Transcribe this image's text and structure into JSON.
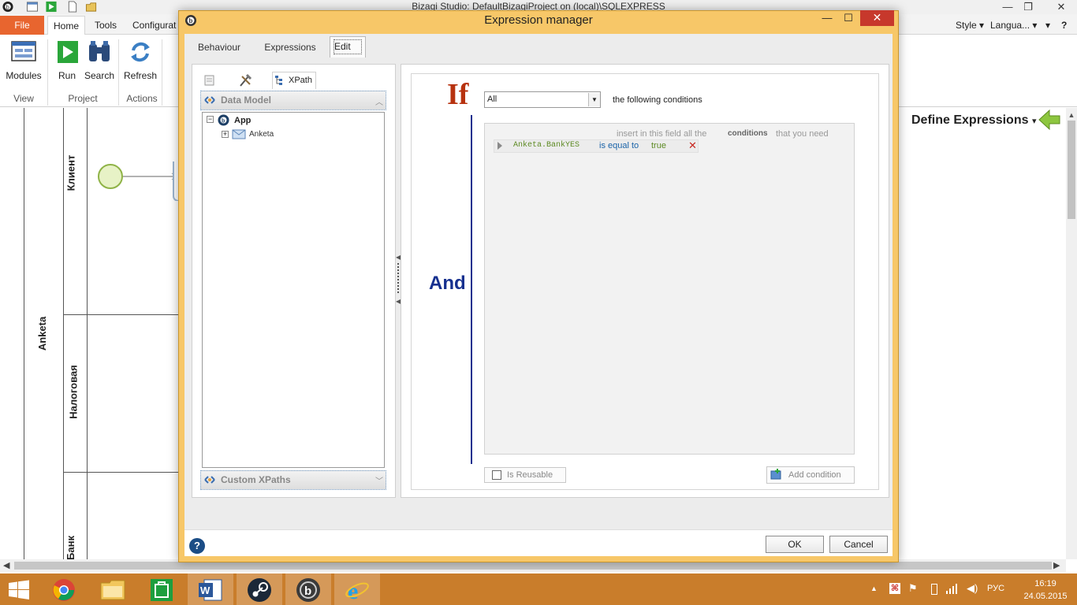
{
  "window": {
    "title": "Bizagi Studio: DefaultBizagiProject on (local)\\SQLEXPRESS",
    "minimize": "—",
    "restore": "❐",
    "close": "✕"
  },
  "ribbon": {
    "tabs": [
      "File",
      "Home",
      "Tools",
      "Configurat"
    ],
    "right": {
      "style": "Style",
      "language": "Langua..."
    },
    "buttons": {
      "modules": "Modules",
      "run": "Run",
      "search": "Search",
      "refresh": "Refresh"
    },
    "groups": {
      "view": "View",
      "project": "Project",
      "actions": "Actions"
    }
  },
  "diagram": {
    "pool": "Anketa",
    "lanes": [
      "Клиент",
      "Налоговая",
      "Банк"
    ]
  },
  "right_pane": {
    "title": "Define Expressions",
    "chevron": "▾"
  },
  "dialog": {
    "title": "Expression manager",
    "min": "—",
    "max": "☐",
    "close": "✕",
    "tabs": {
      "behaviour": "Behaviour",
      "expressions": "Expressions",
      "edit": "Edit"
    },
    "left": {
      "xpath_tab": "XPath",
      "data_model": "Data Model",
      "tree_root": "App",
      "tree_child": "Anketa",
      "custom_xpaths": "Custom XPaths"
    },
    "editor": {
      "if": "If",
      "and": "And",
      "combo_value": "All",
      "following": "the following conditions",
      "hint_1": "insert in this field all the",
      "hint_2": "conditions",
      "hint_3": "that you need",
      "condition": {
        "field": "Anketa.BankYES",
        "operator": "is equal to",
        "value": "true",
        "delete": "✕"
      },
      "reusable": "Is Reusable",
      "add_condition": "Add condition"
    },
    "footer": {
      "help": "?",
      "ok": "OK",
      "cancel": "Cancel"
    }
  },
  "taskbar": {
    "lang": "РУС",
    "time": "16:19",
    "date": "24.05.2015"
  },
  "colors": {
    "accent": "#e8652f",
    "dialog_frame": "#f7c768",
    "taskbar": "#c97d2b",
    "if_red": "#b7320f",
    "and_blue": "#16308f"
  }
}
